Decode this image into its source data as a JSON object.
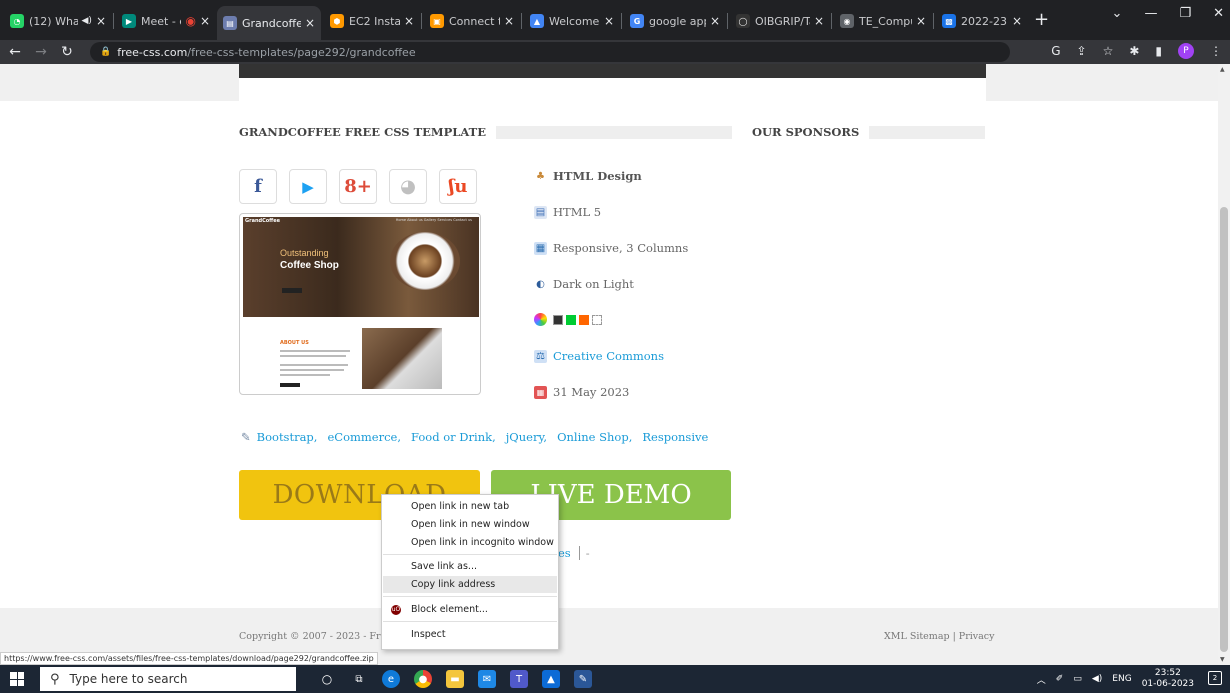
{
  "browser": {
    "tabs": [
      {
        "title": "(12) Wha",
        "icon": "whatsapp-icon",
        "color": "#25d366",
        "glyph": "◔"
      },
      {
        "title": "Meet - e",
        "icon": "meet-icon",
        "color": "#00897b",
        "glyph": "▶"
      },
      {
        "title": "Grandcoffee",
        "icon": "free-css-icon",
        "color": "#6d7dae",
        "glyph": "▤"
      },
      {
        "title": "EC2 Instance",
        "icon": "aws-icon",
        "color": "#ff9900",
        "glyph": "⬢"
      },
      {
        "title": "Connect to i",
        "icon": "aws-console-icon",
        "color": "#ff9900",
        "glyph": "▣"
      },
      {
        "title": "Welcome – I",
        "icon": "drive-icon",
        "color": "#4285f4",
        "glyph": "▲"
      },
      {
        "title": "google app",
        "icon": "google-icon",
        "color": "#4285f4",
        "glyph": "G"
      },
      {
        "title": "OIBGRIP/Tas",
        "icon": "github-icon",
        "color": "#333333",
        "glyph": "◯"
      },
      {
        "title": "TE_Compute",
        "icon": "chrome-icon",
        "color": "#5f6368",
        "glyph": "◉"
      },
      {
        "title": "2022-23 TE (",
        "icon": "classroom-icon",
        "color": "#1a73e8",
        "glyph": "▩"
      }
    ],
    "new_tab_label": "+",
    "url_host": "free-css.com",
    "url_path": "/free-css-templates/page292/grandcoffee",
    "profile_initial": "P"
  },
  "page": {
    "left_heading": "GRANDCOFFEE FREE CSS TEMPLATE",
    "right_heading": "OUR SPONSORS",
    "social": [
      {
        "name": "facebook-share",
        "glyph": "f",
        "color": "#3b5998"
      },
      {
        "name": "twitter-share",
        "glyph": "🐦",
        "color": "#1da1f2"
      },
      {
        "name": "google-plus-share",
        "glyph": "8+",
        "color": "#dd4b39"
      },
      {
        "name": "reddit-share",
        "glyph": "◕",
        "color": "#c0c0c0"
      },
      {
        "name": "stumbleupon-share",
        "glyph": "ʃu",
        "color": "#eb4924"
      }
    ],
    "thumbnail": {
      "brand": "GrandCoffee",
      "menu": "Home  About us  Gallery  Services  Contact us",
      "hero_line1": "Outstanding",
      "hero_line2": "Coffee Shop",
      "about_title": "ABOUT US"
    },
    "meta": {
      "designer": "HTML Design",
      "html_version": "HTML 5",
      "layout": "Responsive, 3 Columns",
      "scheme": "Dark on Light",
      "colors": [
        "#333333",
        "#00cc33",
        "#ff6600",
        "#ffffff"
      ],
      "license": "Creative Commons",
      "date": "31 May 2023"
    },
    "tags": [
      "Bootstrap,",
      "eCommerce,",
      "Food or Drink,",
      "jQuery,",
      "Online Shop,",
      "Responsive"
    ],
    "download_label": "DOWNLOAD",
    "live_demo_label": "LIVE DEMO",
    "sub_link": "es",
    "sub_sep": "-",
    "copyright": "Copyright © 2007 - 2023 - Free C",
    "footer_links": "XML Sitemap | Privacy",
    "status_url": "https://www.free-css.com/assets/files/free-css-templates/download/page292/grandcoffee.zip"
  },
  "context_menu": {
    "items": [
      "Open link in new tab",
      "Open link in new window",
      "Open link in incognito window",
      "Save link as...",
      "Copy link address",
      "Block element...",
      "Inspect"
    ]
  },
  "taskbar": {
    "search_placeholder": "Type here to search",
    "language": "ENG",
    "time": "23:52",
    "date": "01-06-2023",
    "notification_count": "2"
  }
}
